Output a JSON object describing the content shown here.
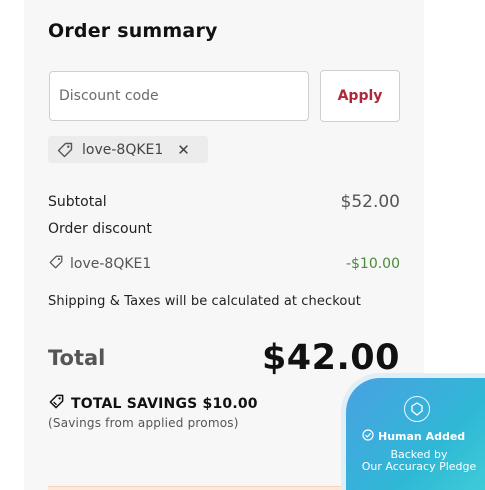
{
  "summary": {
    "title": "Order summary",
    "discount_placeholder": "Discount code",
    "apply_label": "Apply",
    "applied_code": "love-8QKE1",
    "remove_symbol": "✕"
  },
  "lines": {
    "subtotal_label": "Subtotal",
    "subtotal_value": "$52.00",
    "order_discount_label": "Order discount",
    "discount_code": "love-8QKE1",
    "discount_value": "-$10.00",
    "shipping_note": "Shipping & Taxes will be calculated at checkout",
    "total_label": "Total",
    "total_value": "$42.00",
    "savings_text": "TOTAL SAVINGS $10.00",
    "savings_note": "(Savings from applied promos)"
  },
  "badge": {
    "line1": "Human Added",
    "line2": "Backed by",
    "line3": "Our Accuracy Pledge"
  },
  "colors": {
    "accent": "#b0263b",
    "discount_green": "#4a8a3a",
    "badge_blue": "#2fb8d6"
  },
  "icons": {
    "tag": "tag-icon",
    "remove": "close-icon",
    "savings": "tag-icon",
    "badge_logo": "shield-logo-icon",
    "check": "check-circle-icon"
  }
}
